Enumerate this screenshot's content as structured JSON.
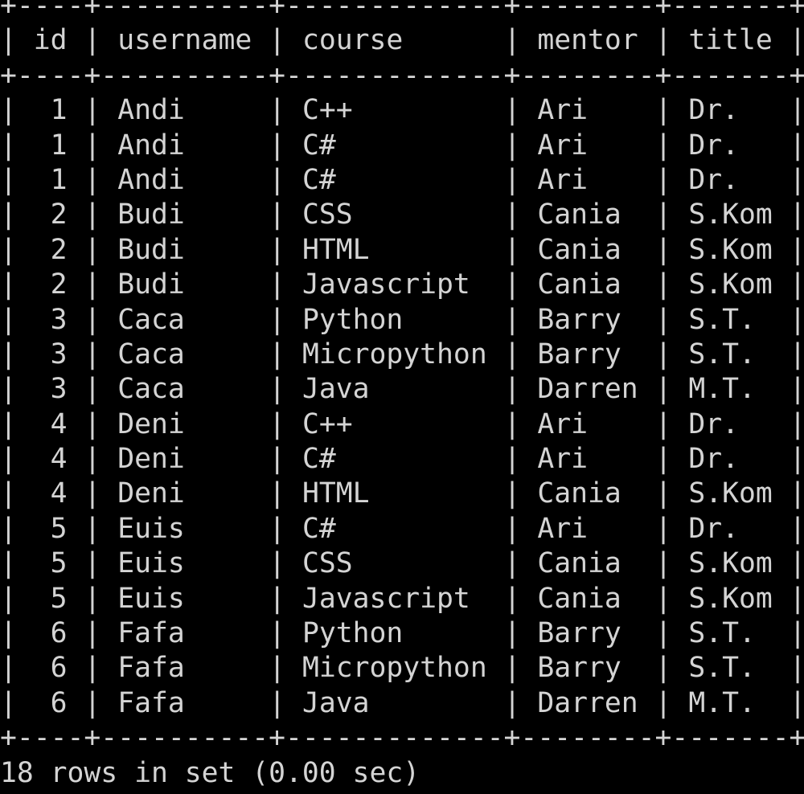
{
  "terminal": {
    "columns": [
      "id",
      "username",
      "course",
      "mentor",
      "title"
    ],
    "numeric_columns": [
      "id"
    ],
    "rows": [
      [
        "1",
        "Andi",
        "C++",
        "Ari",
        "Dr."
      ],
      [
        "1",
        "Andi",
        "C#",
        "Ari",
        "Dr."
      ],
      [
        "1",
        "Andi",
        "C#",
        "Ari",
        "Dr."
      ],
      [
        "2",
        "Budi",
        "CSS",
        "Cania",
        "S.Kom"
      ],
      [
        "2",
        "Budi",
        "HTML",
        "Cania",
        "S.Kom"
      ],
      [
        "2",
        "Budi",
        "Javascript",
        "Cania",
        "S.Kom"
      ],
      [
        "3",
        "Caca",
        "Python",
        "Barry",
        "S.T."
      ],
      [
        "3",
        "Caca",
        "Micropython",
        "Barry",
        "S.T."
      ],
      [
        "3",
        "Caca",
        "Java",
        "Darren",
        "M.T."
      ],
      [
        "4",
        "Deni",
        "C++",
        "Ari",
        "Dr."
      ],
      [
        "4",
        "Deni",
        "C#",
        "Ari",
        "Dr."
      ],
      [
        "4",
        "Deni",
        "HTML",
        "Cania",
        "S.Kom"
      ],
      [
        "5",
        "Euis",
        "C#",
        "Ari",
        "Dr."
      ],
      [
        "5",
        "Euis",
        "CSS",
        "Cania",
        "S.Kom"
      ],
      [
        "5",
        "Euis",
        "Javascript",
        "Cania",
        "S.Kom"
      ],
      [
        "6",
        "Fafa",
        "Python",
        "Barry",
        "S.T."
      ],
      [
        "6",
        "Fafa",
        "Micropython",
        "Barry",
        "S.T."
      ],
      [
        "6",
        "Fafa",
        "Java",
        "Darren",
        "M.T."
      ]
    ],
    "footer": "18 rows in set (0.00 sec)",
    "colors": {
      "background": "#000000",
      "text": "#d4d4d4"
    }
  }
}
